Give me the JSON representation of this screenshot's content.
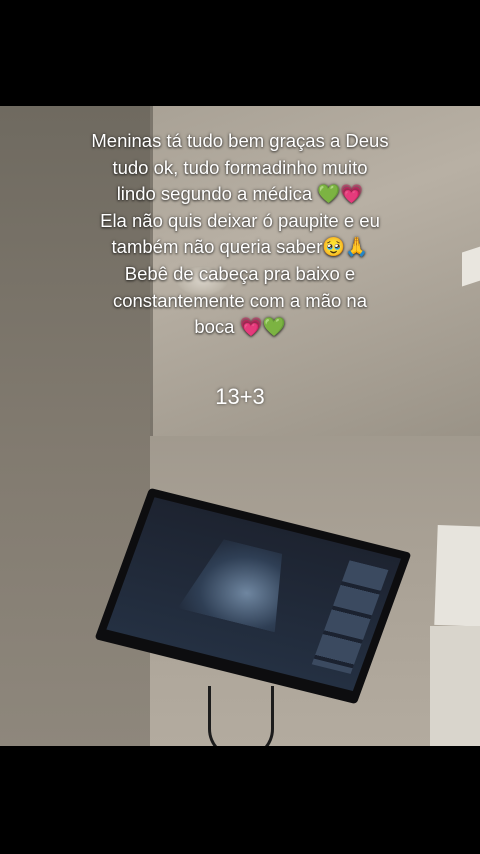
{
  "caption": {
    "lines": [
      "Meninas tá tudo bem graças a Deus",
      "tudo ok, tudo formadinho muito",
      "lindo segundo a médica 💚💗",
      "Ela não quis deixar ó paupite e eu",
      "também não queria saber🥹🙏",
      "Bebê de cabeça pra baixo e",
      "constantemente com a mão na",
      "boca 💗💚"
    ]
  },
  "counter": "13+3"
}
